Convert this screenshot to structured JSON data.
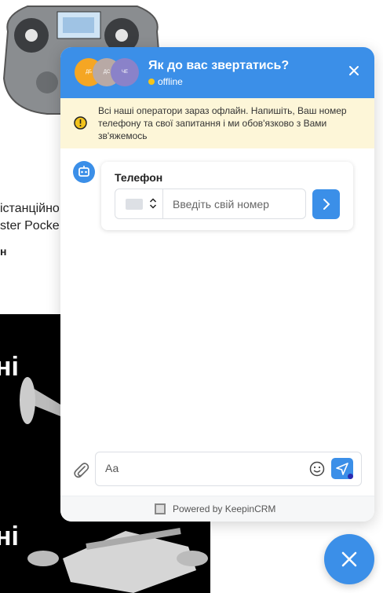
{
  "background": {
    "line1": "істанційно",
    "line2": "ster Pocke",
    "line3": "н",
    "banner1": "ні",
    "banner2": "ні"
  },
  "widget": {
    "avatars": [
      {
        "initials": "ДБ",
        "color": "#f5a623"
      },
      {
        "initials": "ДС",
        "color": "#b8a9a5"
      },
      {
        "initials": "ЧЕ",
        "color": "#8a82c9"
      }
    ],
    "title": "Як до вас звертатись?",
    "status": "offline",
    "notice": "Всі наші оператори зараз офлайн. Напишіть, Ваш номер телефону та свої запитання і ми обов'язково з Вами зв'яжемось",
    "form": {
      "label": "Телефон",
      "placeholder": "Введіть свій номер"
    },
    "composer": {
      "placeholder": "Аа"
    },
    "footer": "Powered by KeepinCRM"
  },
  "colors": {
    "accent": "#3b8fe8",
    "notice_bg": "#fdf6d8",
    "status": "#f5c518"
  }
}
